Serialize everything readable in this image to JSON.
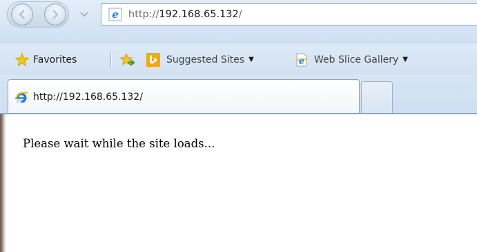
{
  "navigation": {
    "back_icon": "back-arrow-icon",
    "forward_icon": "forward-arrow-icon",
    "recent_pages_icon": "chevron-down-icon"
  },
  "address_bar": {
    "scheme": "http://",
    "host": "192.168.65.132",
    "path": "/",
    "favicon": "ie-logo-icon"
  },
  "favorites_bar": {
    "favorites_label": "Favorites",
    "favorites_icon": "star-icon",
    "add_icon": "add-to-favorites-icon",
    "items": [
      {
        "label": "Suggested Sites",
        "icon": "bing-icon",
        "has_dropdown": true
      },
      {
        "label": "Web Slice Gallery",
        "icon": "ie-page-icon",
        "has_dropdown": true
      }
    ]
  },
  "tabs": [
    {
      "label": "http://192.168.65.132/",
      "active": true,
      "icon": "ie-logo-icon"
    }
  ],
  "content": {
    "message": "Please wait while the site loads..."
  },
  "colors": {
    "chrome_blue": "#d6e5f6",
    "border_blue": "#8ea4bd",
    "bing_orange": "#f2a90e",
    "ie_blue": "#1e7fd6"
  }
}
